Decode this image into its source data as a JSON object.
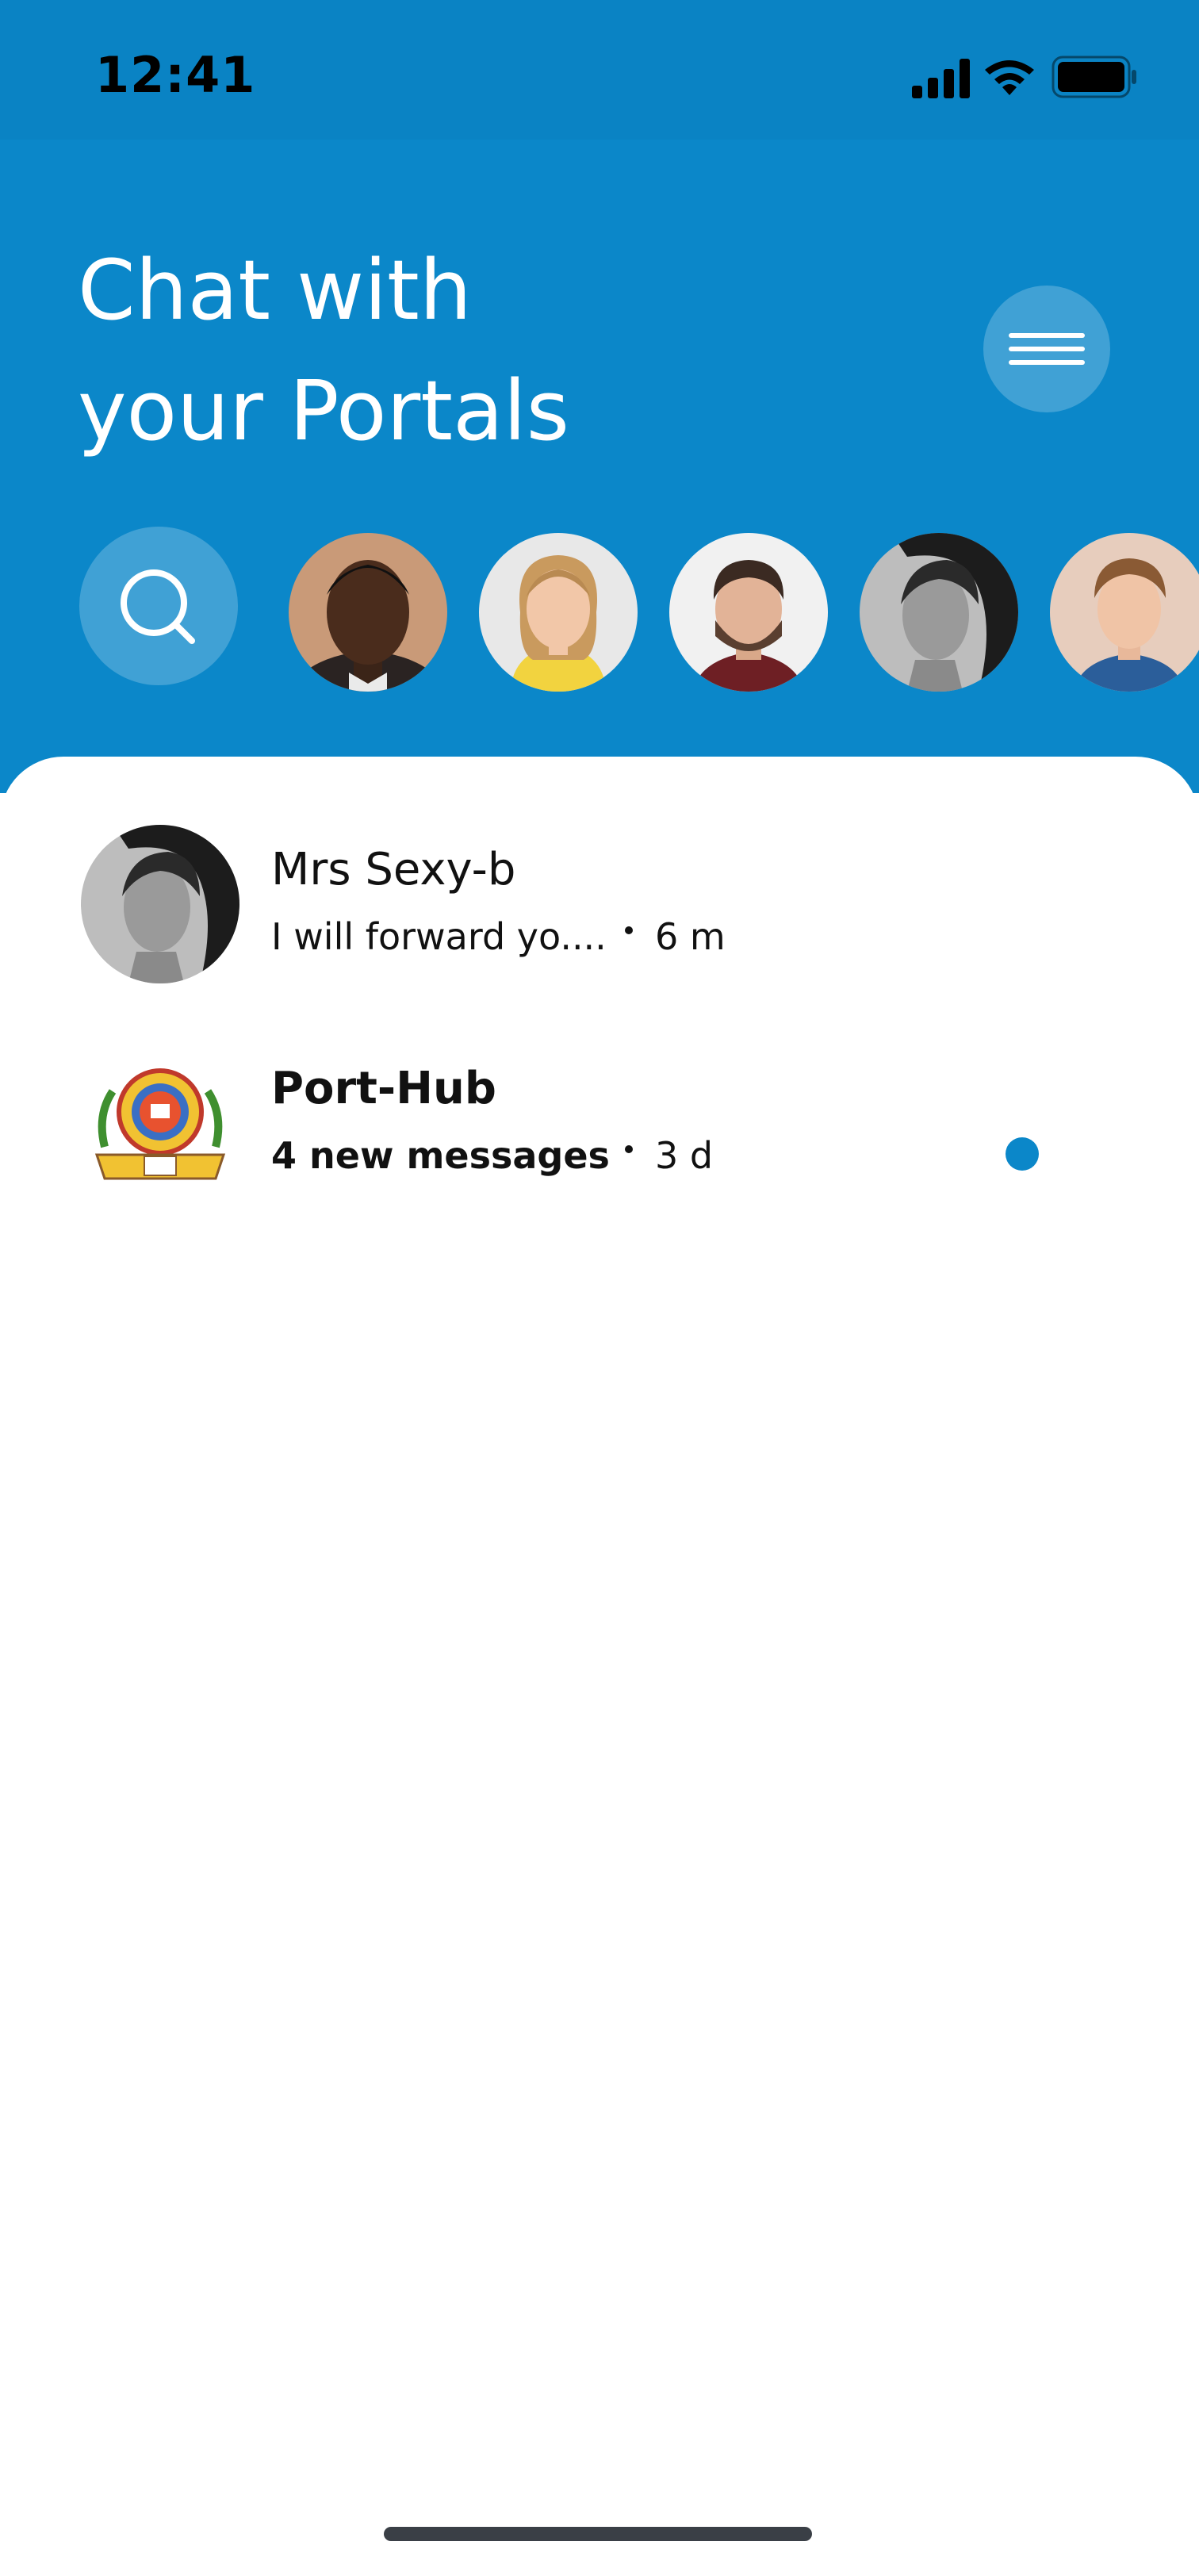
{
  "status_bar": {
    "time": "12:41",
    "signal_icon": "cellular-signal-icon",
    "wifi_icon": "wifi-icon",
    "battery_icon": "battery-icon"
  },
  "header": {
    "title_line1": "Chat with",
    "title_line2": "your Portals",
    "menu_icon": "hamburger-menu-icon",
    "search_icon": "search-icon"
  },
  "stories": [
    {
      "name": "story-avatar-1"
    },
    {
      "name": "story-avatar-2"
    },
    {
      "name": "story-avatar-3"
    },
    {
      "name": "story-avatar-4"
    },
    {
      "name": "story-avatar-5"
    }
  ],
  "chats": [
    {
      "name": "Mrs Sexy-b",
      "preview": "I will forward yo....",
      "time": "6 m",
      "unread": false
    },
    {
      "name": "Port-Hub",
      "preview": "4 new messages",
      "time": "3 d",
      "unread": true
    }
  ],
  "colors": {
    "accent": "#0b87c9",
    "header_bg": "#0b87c9",
    "status_bg": "#0a83c4"
  }
}
